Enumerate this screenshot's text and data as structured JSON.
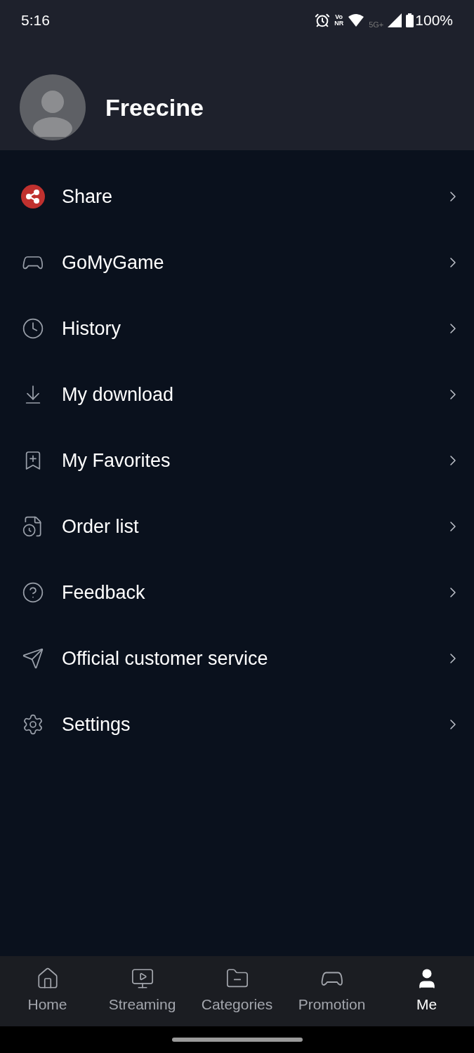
{
  "status_bar": {
    "time": "5:16",
    "volte_top": "Vo",
    "volte_bottom": "NR",
    "network": "5G+",
    "battery": "100%"
  },
  "profile": {
    "name": "Freecine"
  },
  "menu": [
    {
      "kind": "share",
      "label": "Share"
    },
    {
      "kind": "game",
      "label": "GoMyGame"
    },
    {
      "kind": "history",
      "label": "History"
    },
    {
      "kind": "download",
      "label": "My download"
    },
    {
      "kind": "favorites",
      "label": "My Favorites"
    },
    {
      "kind": "orders",
      "label": "Order list"
    },
    {
      "kind": "feedback",
      "label": "Feedback"
    },
    {
      "kind": "service",
      "label": "Official customer service"
    },
    {
      "kind": "settings",
      "label": "Settings"
    }
  ],
  "bottom_nav": [
    {
      "kind": "home",
      "label": "Home",
      "selected": false
    },
    {
      "kind": "streaming",
      "label": "Streaming",
      "selected": false
    },
    {
      "kind": "categories",
      "label": "Categories",
      "selected": false
    },
    {
      "kind": "promotion",
      "label": "Promotion",
      "selected": false
    },
    {
      "kind": "me",
      "label": "Me",
      "selected": true
    }
  ]
}
